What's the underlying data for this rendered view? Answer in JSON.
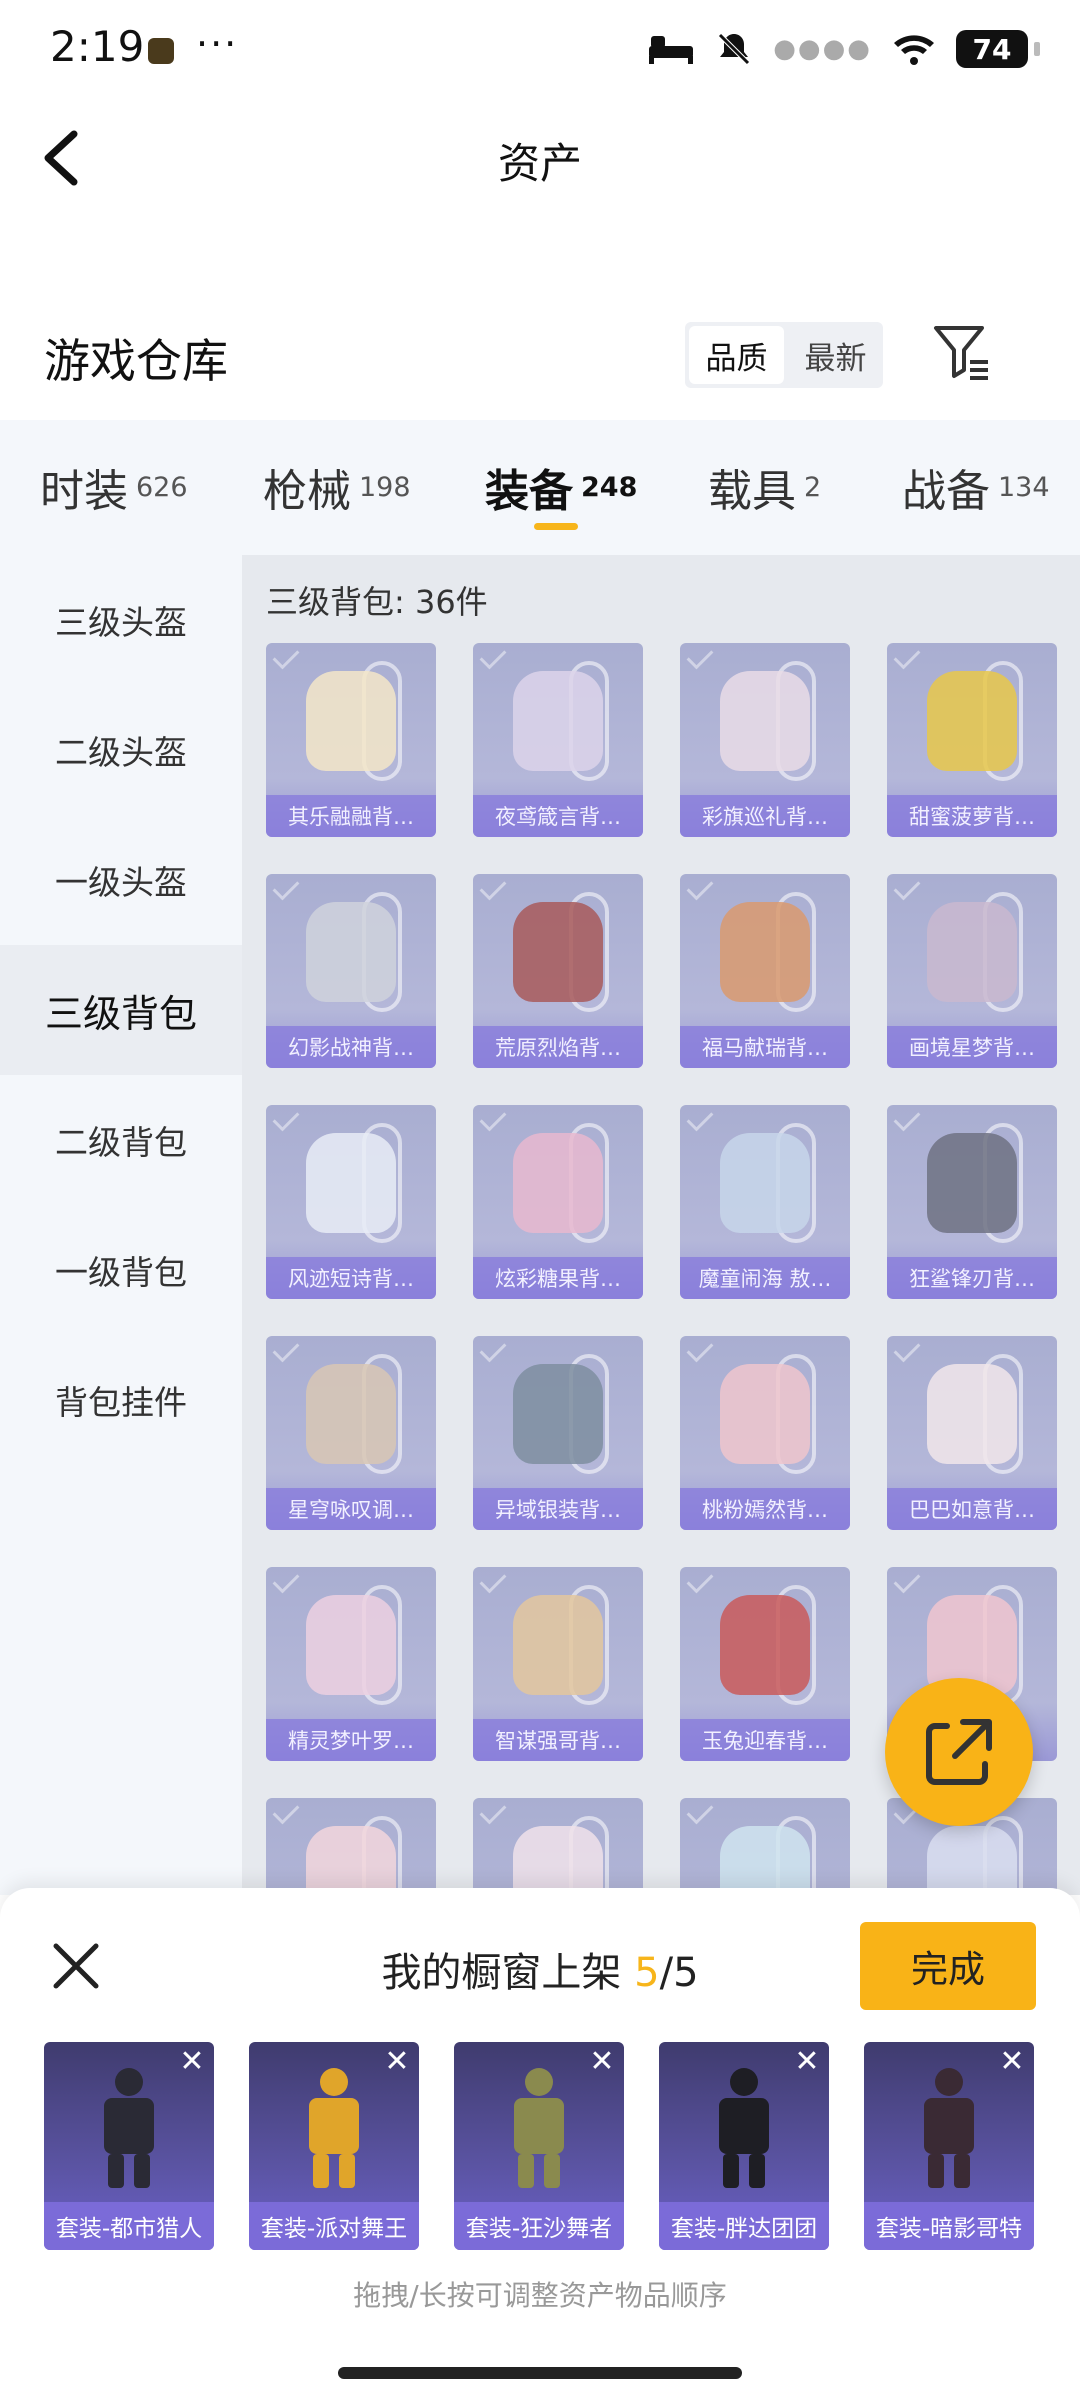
{
  "status_bar": {
    "time": "2:19",
    "more": "···",
    "battery": "74"
  },
  "header": {
    "title": "资产"
  },
  "warehouse": {
    "title": "游戏仓库",
    "sort_options": [
      "品质",
      "最新"
    ],
    "sort_selected": "品质"
  },
  "tabs": [
    {
      "label": "时装",
      "count": "626"
    },
    {
      "label": "枪械",
      "count": "198"
    },
    {
      "label": "装备",
      "count": "248"
    },
    {
      "label": "载具",
      "count": "2"
    },
    {
      "label": "战备",
      "count": "134"
    }
  ],
  "active_tab": "装备",
  "sidebar": {
    "items": [
      "三级头盔",
      "二级头盔",
      "一级头盔",
      "三级背包",
      "二级背包",
      "一级背包",
      "背包挂件"
    ],
    "active": "三级背包"
  },
  "grid": {
    "count_label": "三级背包: 36件",
    "items": [
      {
        "name": "其乐融融背…",
        "color": "#f3e6c8"
      },
      {
        "name": "夜鸢箴言背…",
        "color": "#dcd3ea"
      },
      {
        "name": "彩旗巡礼背…",
        "color": "#e9dce6"
      },
      {
        "name": "甜蜜菠萝背…",
        "color": "#e7c84a"
      },
      {
        "name": "幻影战神背…",
        "color": "#cfd2dc"
      },
      {
        "name": "荒原烈焰背…",
        "color": "#a85a5a"
      },
      {
        "name": "福马献瑞背…",
        "color": "#d99a6e"
      },
      {
        "name": "画境星梦背…",
        "color": "#c9b9cf"
      },
      {
        "name": "风迹短诗背…",
        "color": "#e8ecf6"
      },
      {
        "name": "炫彩糖果背…",
        "color": "#e7b9cf"
      },
      {
        "name": "魔童闹海 敖…",
        "color": "#c7d6ea"
      },
      {
        "name": "狂鲨锋刃背…",
        "color": "#6f7283"
      },
      {
        "name": "星穹咏叹调…",
        "color": "#d8c7b4"
      },
      {
        "name": "异域银装背…",
        "color": "#7e8ea0"
      },
      {
        "name": "桃粉嫣然背…",
        "color": "#efc6cc"
      },
      {
        "name": "巴巴如意背…",
        "color": "#f1e6ea"
      },
      {
        "name": "精灵梦叶罗…",
        "color": "#ecd0e0"
      },
      {
        "name": "智谋强哥背…",
        "color": "#e3c79d"
      },
      {
        "name": "玉兔迎春背…",
        "color": "#c95a5a"
      },
      {
        "name": "",
        "color": "#f0c6cf"
      },
      {
        "name": "",
        "color": "#f2d6dc"
      },
      {
        "name": "",
        "color": "#f0e2ea"
      },
      {
        "name": "",
        "color": "#cfe4ee"
      },
      {
        "name": "",
        "color": "#d9def0"
      }
    ]
  },
  "showcase": {
    "title": "我的橱窗上架",
    "current": "5",
    "total": "/5",
    "done_label": "完成",
    "items": [
      {
        "name": "套装-都市猎人",
        "color": "#2a2a35"
      },
      {
        "name": "套装-派对舞王",
        "color": "#e0a52a"
      },
      {
        "name": "套装-狂沙舞者",
        "color": "#8a8a4e"
      },
      {
        "name": "套装-胖达团团",
        "color": "#1e1e24"
      },
      {
        "name": "套装-暗影哥特",
        "color": "#3a2a34"
      }
    ],
    "hint": "拖拽/长按可调整资产物品顺序"
  },
  "colors": {
    "accent": "#f9b317",
    "item_bg": "#a9aed1",
    "showcase_bg": "#5b54a3"
  }
}
